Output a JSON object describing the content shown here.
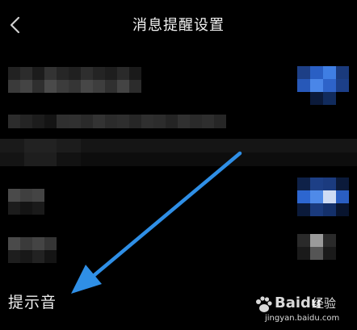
{
  "header": {
    "title": "消息提醒设置",
    "back_icon": "chevron-left-icon"
  },
  "rows": {
    "sound_label": "提示音"
  },
  "watermark": {
    "brand": "Baidu",
    "jingyan": "经验",
    "url": "jingyan.baidu.com"
  },
  "colors": {
    "background": "#000000",
    "annotation_arrow": "#2f8fe6",
    "toggle_blue": "#2d6fd6"
  }
}
